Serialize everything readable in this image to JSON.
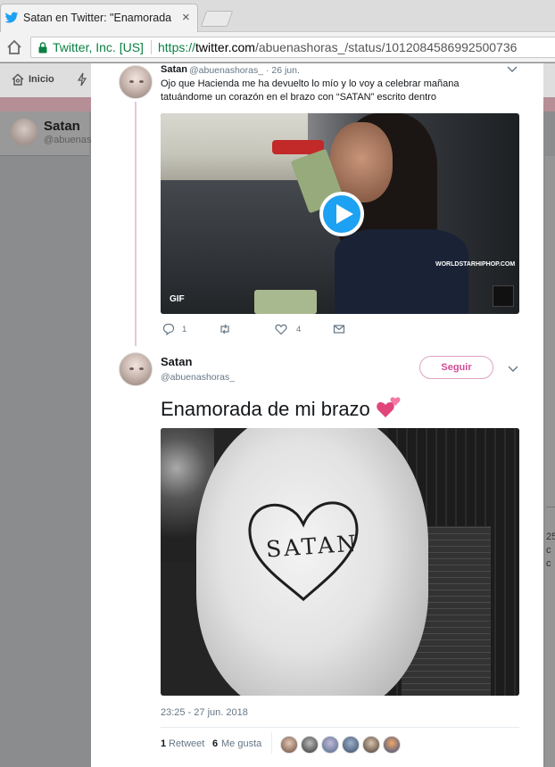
{
  "browser": {
    "tab_title": "Satan en Twitter: \"Enamorada",
    "close_glyph": "×",
    "secure_org": "Twitter, Inc. [US]",
    "url_protocol": "https://",
    "url_host": "twitter.com",
    "url_path": "/abuenashoras_/status/1012084586992500736"
  },
  "background": {
    "nav_home": "Inicio",
    "profile_name": "Satan",
    "profile_handle": "@abuenas",
    "right_text": "25\nc\nc"
  },
  "parent_tweet": {
    "name": "Satan",
    "meta": "@abuenashoras_ · 26 jun.",
    "text": "Ojo que Hacienda me ha devuelto lo mío y lo voy a celebrar mañana tatuándome un corazón en el brazo con “SATAN” escrito dentro",
    "gif_label": "GIF",
    "gif_watermark": "WORLDSTARHIPHOP.COM",
    "reply_count": "1",
    "retweet_count": "",
    "like_count": "4"
  },
  "main_tweet": {
    "name": "Satan",
    "handle": "@abuenashoras_",
    "follow_label": "Seguir",
    "text": "Enamorada de mi brazo",
    "photo_word": "SATAN",
    "timestamp": "23:25 - 27 jun. 2018",
    "retweets_num": "1",
    "retweets_label": "Retweet",
    "likes_num": "6",
    "likes_label": "Me gusta"
  },
  "colors": {
    "accent": "#1da1f2",
    "follow": "#d34b97",
    "thread_line": "#e9c6d8",
    "secure": "#0b8043"
  },
  "icons": [
    "twitter-bird-icon",
    "home-icon",
    "lock-icon",
    "chevron-down-icon",
    "play-icon",
    "reply-icon",
    "retweet-icon",
    "like-icon",
    "message-icon",
    "two-hearts-icon",
    "bolt-icon"
  ]
}
